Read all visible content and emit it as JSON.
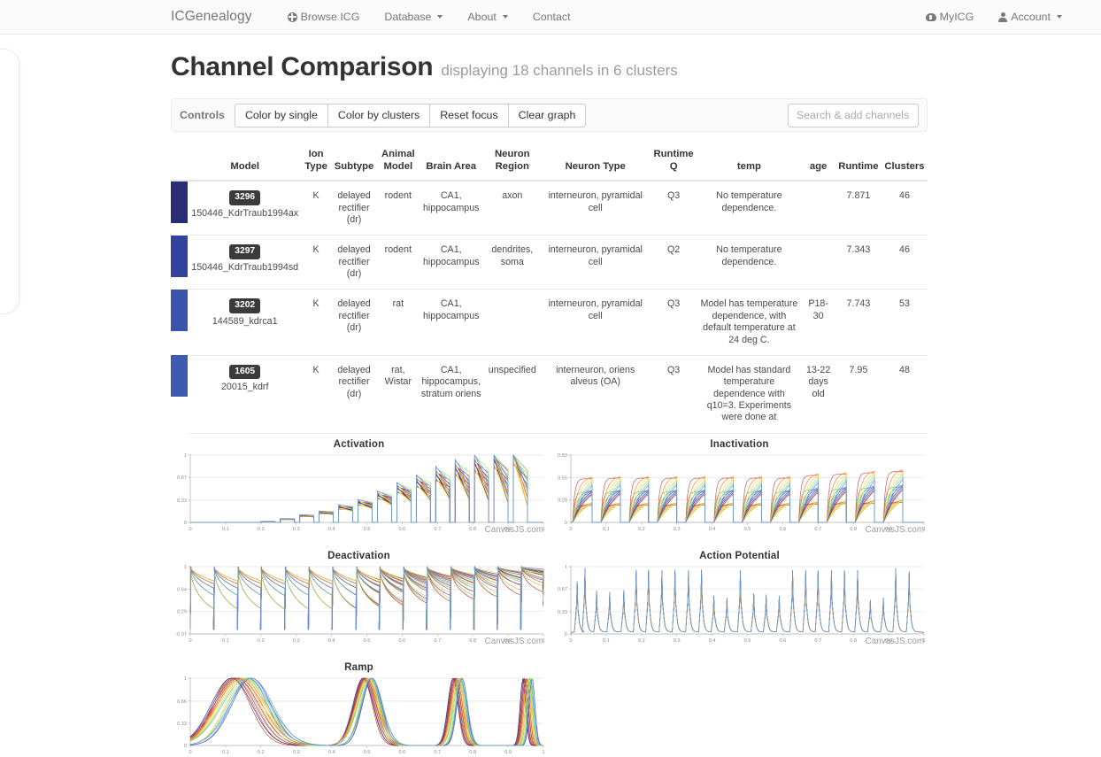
{
  "navbar": {
    "brand": "ICGenealogy",
    "links": [
      {
        "label": "Browse ICG",
        "icon": "globe-icon",
        "caret": false
      },
      {
        "label": "Database",
        "icon": null,
        "caret": true
      },
      {
        "label": "About",
        "icon": null,
        "caret": true
      },
      {
        "label": "Contact",
        "icon": null,
        "caret": false
      }
    ],
    "right": [
      {
        "label": "MyICG",
        "icon": "cloud-upload-icon",
        "caret": false
      },
      {
        "label": "Account",
        "icon": "user-icon",
        "caret": true
      }
    ]
  },
  "header": {
    "title": "Channel Comparison",
    "subtitle": "displaying 18 channels in 6 clusters"
  },
  "controls": {
    "label": "Controls",
    "buttons": [
      "Color by single",
      "Color by clusters",
      "Reset focus",
      "Clear graph"
    ],
    "search_placeholder": "Search & add channels",
    "search_value": ""
  },
  "table": {
    "headers": {
      "model": "Model",
      "ion_type": "Ion\nType",
      "ion_type_l1": "Ion",
      "ion_type_l2": "Type",
      "subtype": "Subtype",
      "animal_model_l1": "Animal",
      "animal_model_l2": "Model",
      "brain_area": "Brain Area",
      "neuron_region_l1": "Neuron",
      "neuron_region_l2": "Region",
      "neuron_type": "Neuron Type",
      "runtime_q_l1": "Runtime",
      "runtime_q_l2": "Q",
      "temp": "temp",
      "age": "age",
      "runtime": "Runtime",
      "clusters": "Clusters"
    },
    "rows": [
      {
        "color": "#2b2d74",
        "id": "3296",
        "name": "150446_KdrTraub1994ax",
        "ion_type": "K",
        "subtype": "delayed rectifier (dr)",
        "animal_model": "rodent",
        "brain_area": "CA1, hippocampus",
        "neuron_region": "axon",
        "neuron_type": "interneuron, pyramidal cell",
        "runtime_q": "Q3",
        "temp": "No temperature dependence.",
        "age": "",
        "runtime": "7.871",
        "clusters": "46"
      },
      {
        "color": "#32439e",
        "id": "3297",
        "name": "150446_KdrTraub1994sd",
        "ion_type": "K",
        "subtype": "delayed rectifier (dr)",
        "animal_model": "rodent",
        "brain_area": "CA1, hippocampus",
        "neuron_region": "dendrites, soma",
        "neuron_type": "interneuron, pyramidal cell",
        "runtime_q": "Q2",
        "temp": "No temperature dependence.",
        "age": "",
        "runtime": "7.343",
        "clusters": "46"
      },
      {
        "color": "#3a54ab",
        "id": "3202",
        "name": "144589_kdrca1",
        "ion_type": "K",
        "subtype": "delayed rectifier (dr)",
        "animal_model": "rat",
        "brain_area": "CA1, hippocampus",
        "neuron_region": "",
        "neuron_type": "interneuron, pyramidal cell",
        "runtime_q": "Q3",
        "temp": "Model has temperature dependence, with default temperature at 24 deg C.",
        "age": "P18-30",
        "runtime": "7.743",
        "clusters": "53"
      },
      {
        "color": "#3d5cb0",
        "id": "1605",
        "name": "20015_kdrf",
        "ion_type": "K",
        "subtype": "delayed rectifier (dr)",
        "animal_model": "rat, Wistar",
        "brain_area": "CA1, hippocampus, stratum oriens",
        "neuron_region": "unspecified",
        "neuron_type": "interneuron, oriens alveus (OA)",
        "runtime_q": "Q3",
        "temp": "Model has standard temperature dependence with q10=3. Experiments were done at",
        "age": "13-22 days old",
        "runtime": "7.95",
        "clusters": "48"
      }
    ]
  },
  "charts": {
    "credit": "CanvasJS.com",
    "items": [
      {
        "title": "Activation"
      },
      {
        "title": "Inactivation"
      },
      {
        "title": "Deactivation"
      },
      {
        "title": "Action Potential"
      },
      {
        "title": "Ramp"
      }
    ]
  },
  "chart_data": [
    {
      "type": "line",
      "title": "Activation",
      "xlabel": "",
      "ylabel": "",
      "xlim": [
        0,
        1
      ],
      "ylim": [
        0,
        1
      ],
      "xticks": [
        "0",
        "0.1",
        "0.2",
        "0.3",
        "0.4",
        "0.5",
        "0.6",
        "0.7",
        "0.8",
        "0.9",
        "1"
      ],
      "yticks": [
        "0",
        "0.33",
        "0.67",
        "1"
      ],
      "grid": true,
      "description": "Staircase of voltage-step responses; each step pulse rises to a progressively higher plateau then decays.",
      "series": [
        {
          "name": "traces",
          "color": "#c0392b",
          "step_starts": [
            0.2,
            0.255,
            0.31,
            0.365,
            0.42,
            0.475,
            0.53,
            0.585,
            0.64,
            0.695,
            0.75,
            0.805,
            0.86,
            0.915
          ],
          "step_widths": 0.04,
          "plateaus": [
            0.01,
            0.05,
            0.1,
            0.15,
            0.23,
            0.3,
            0.41,
            0.52,
            0.62,
            0.73,
            0.82,
            0.89,
            0.95,
            1.0
          ]
        }
      ]
    },
    {
      "type": "line",
      "title": "Inactivation",
      "xlabel": "",
      "ylabel": "",
      "xlim": [
        0,
        1
      ],
      "ylim": [
        0,
        0.83
      ],
      "xticks": [
        "0",
        "0.1",
        "0.2",
        "0.3",
        "0.4",
        "0.5",
        "0.6",
        "0.7",
        "0.8",
        "0.9",
        "1"
      ],
      "yticks": [
        "0",
        "0.28",
        "0.55",
        "0.83"
      ],
      "grid": true,
      "description": "Twelve repeated square pulses of near-equal amplitude (~0.6-0.8) with exponential rise inside each pulse.",
      "series": [
        {
          "name": "traces",
          "color": "#c0392b",
          "pulse_starts": [
            0.005,
            0.085,
            0.165,
            0.245,
            0.325,
            0.405,
            0.485,
            0.565,
            0.645,
            0.725,
            0.805,
            0.885
          ],
          "pulse_width": 0.055,
          "plateaus": [
            0.65,
            0.66,
            0.66,
            0.66,
            0.66,
            0.66,
            0.66,
            0.66,
            0.7,
            0.72,
            0.74,
            0.76
          ]
        }
      ]
    },
    {
      "type": "line",
      "title": "Deactivation",
      "xlabel": "",
      "ylabel": "",
      "xlim": [
        0,
        1
      ],
      "ylim": [
        -0.07,
        1
      ],
      "xticks": [
        "0",
        "0.1",
        "0.2",
        "0.3",
        "0.4",
        "0.5",
        "0.6",
        "0.7",
        "0.8",
        "0.9",
        "1"
      ],
      "yticks": [
        "-0.07",
        "0.29",
        "0.64",
        "1"
      ],
      "grid": true,
      "description": "Series of spikes to 1 followed by decay to a baseline that rises step-by-step from 0 to ~0.7.",
      "series": [
        {
          "name": "traces",
          "color": "#c0392b",
          "spike_times": [
            0.0,
            0.067,
            0.134,
            0.2,
            0.268,
            0.335,
            0.402,
            0.47,
            0.536,
            0.603,
            0.67,
            0.737,
            0.804,
            0.87,
            0.937
          ],
          "baselines": [
            0.0,
            0.0,
            0.0,
            0.0,
            0.0,
            0.0,
            0.03,
            0.09,
            0.16,
            0.24,
            0.32,
            0.41,
            0.5,
            0.58,
            0.68
          ]
        }
      ]
    },
    {
      "type": "line",
      "title": "Action Potential",
      "xlabel": "",
      "ylabel": "",
      "xlim": [
        0,
        1
      ],
      "ylim": [
        0,
        1
      ],
      "xticks": [
        "0",
        "0.1",
        "0.2",
        "0.3",
        "0.4",
        "0.5",
        "0.6",
        "0.7",
        "0.8",
        "0.9",
        "1"
      ],
      "yticks": [
        "0",
        "0.33",
        "0.67",
        "1"
      ],
      "grid": true,
      "description": "Train of ~27 sharp action-potential spikes of alternating tall (~1.0) and short (~0.6) amplitude.",
      "series": [
        {
          "name": "traces",
          "color": "#c0392b",
          "spike_times": [
            0.018,
            0.04,
            0.073,
            0.11,
            0.15,
            0.185,
            0.22,
            0.258,
            0.295,
            0.333,
            0.37,
            0.405,
            0.442,
            0.48,
            0.518,
            0.553,
            0.59,
            0.628,
            0.665,
            0.7,
            0.738,
            0.775,
            0.812,
            0.848,
            0.885,
            0.92,
            0.958
          ],
          "amplitudes": [
            0.8,
            1.0,
            0.66,
            0.64,
            0.67,
            0.98,
            0.98,
            0.97,
            0.98,
            0.97,
            0.98,
            0.58,
            0.55,
            0.97,
            0.62,
            0.6,
            0.58,
            0.97,
            0.97,
            0.97,
            0.97,
            0.97,
            0.97,
            0.52,
            0.55,
            1.0,
            0.95
          ]
        }
      ]
    },
    {
      "type": "line",
      "title": "Ramp",
      "xlabel": "",
      "ylabel": "",
      "xlim": [
        0,
        1
      ],
      "ylim": [
        0,
        1
      ],
      "xticks": [
        "0",
        "0.1",
        "0.2",
        "0.3",
        "0.4",
        "0.5",
        "0.6",
        "0.7",
        "0.8",
        "0.9",
        "1"
      ],
      "yticks": [
        "0",
        "0.66",
        "0.33",
        "1"
      ],
      "yticks_ordered": [
        "0",
        "0.33",
        "0.66",
        "1"
      ],
      "grid": true,
      "description": "Four bell-shaped ramp responses of decreasing width at x ~0.145, 0.50, 0.755, 0.955; all peak at 1.",
      "series": [
        {
          "name": "traces",
          "color": "#c0392b",
          "peak_positions": [
            0.145,
            0.502,
            0.757,
            0.955
          ],
          "peak_values": [
            1.0,
            1.0,
            1.0,
            1.0
          ],
          "half_widths": [
            0.085,
            0.042,
            0.022,
            0.012
          ]
        }
      ]
    }
  ],
  "trace_colors": [
    "#c0392b",
    "#e8542a",
    "#f0932b",
    "#f6c23e",
    "#e6e64d",
    "#a8cf45",
    "#4bbfa0",
    "#4f8fd6",
    "#3a54ab",
    "#2b2d74",
    "#7b3f9e",
    "#8b2f2f",
    "#d64545",
    "#f08030",
    "#ffd24d",
    "#b6d957",
    "#5fc9c9",
    "#6a87d8"
  ]
}
